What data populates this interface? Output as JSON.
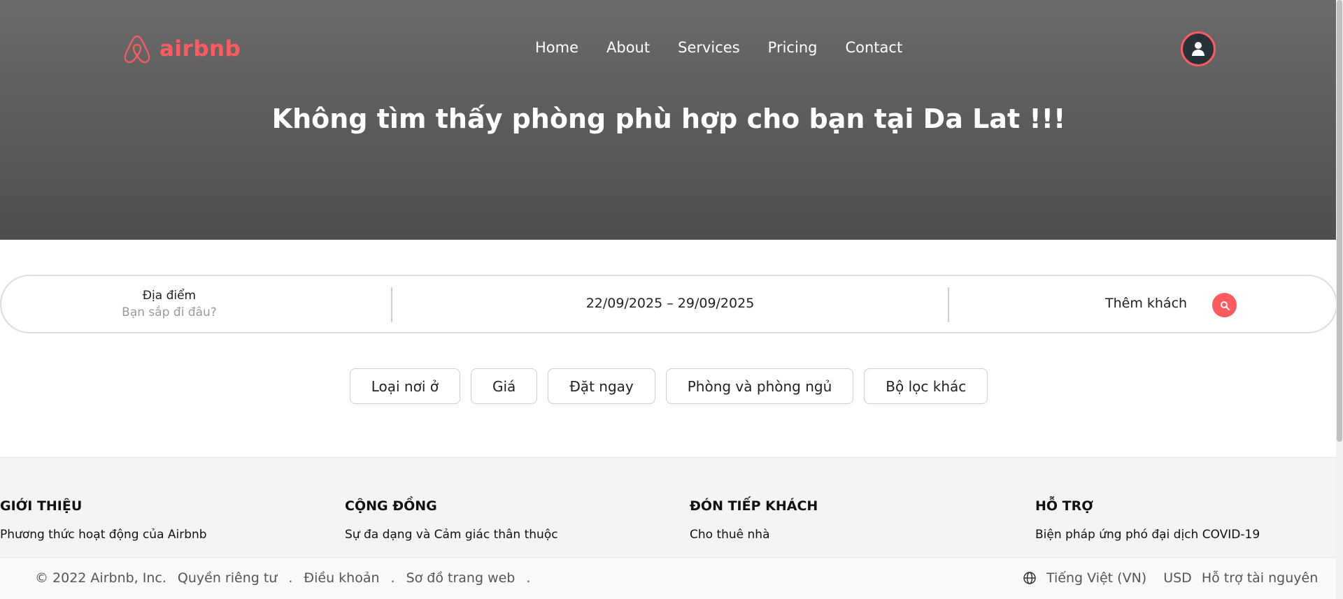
{
  "header": {
    "logo_text": "airbnb",
    "nav": [
      "Home",
      "About",
      "Services",
      "Pricing",
      "Contact"
    ],
    "title": "Không tìm thấy phòng phù hợp cho bạn tại Da Lat !!!"
  },
  "search": {
    "location_label": "Địa điểm",
    "location_placeholder": "Bạn sắp đi đâu?",
    "dates": "22/09/2025 – 29/09/2025",
    "guests": "Thêm khách"
  },
  "filters": [
    "Loại nơi ở",
    "Giá",
    "Đặt ngay",
    "Phòng và phòng ngủ",
    "Bộ lọc khác"
  ],
  "footer": {
    "columns": [
      {
        "heading": "GIỚI THIỆU",
        "item": "Phương thức hoạt động của Airbnb"
      },
      {
        "heading": "CỘNG ĐỒNG",
        "item": "Sự đa dạng và Cảm giác thân thuộc"
      },
      {
        "heading": "ĐÓN TIẾP KHÁCH",
        "item": "Cho thuê nhà"
      },
      {
        "heading": "HỖ TRỢ",
        "item": "Biện pháp ứng phó đại dịch COVID-19"
      }
    ],
    "copyright": "© 2022 Airbnb, Inc.",
    "links": [
      "Quyền riêng tư",
      ".",
      "Điều khoản",
      ".",
      "Sơ đồ trang web",
      "."
    ],
    "language": "Tiếng Việt (VN)",
    "currency": "USD",
    "support": "Hỗ trợ tài nguyên"
  },
  "colors": {
    "brand": "#ff5a5f",
    "hero_bg": "#5c5c5c"
  }
}
